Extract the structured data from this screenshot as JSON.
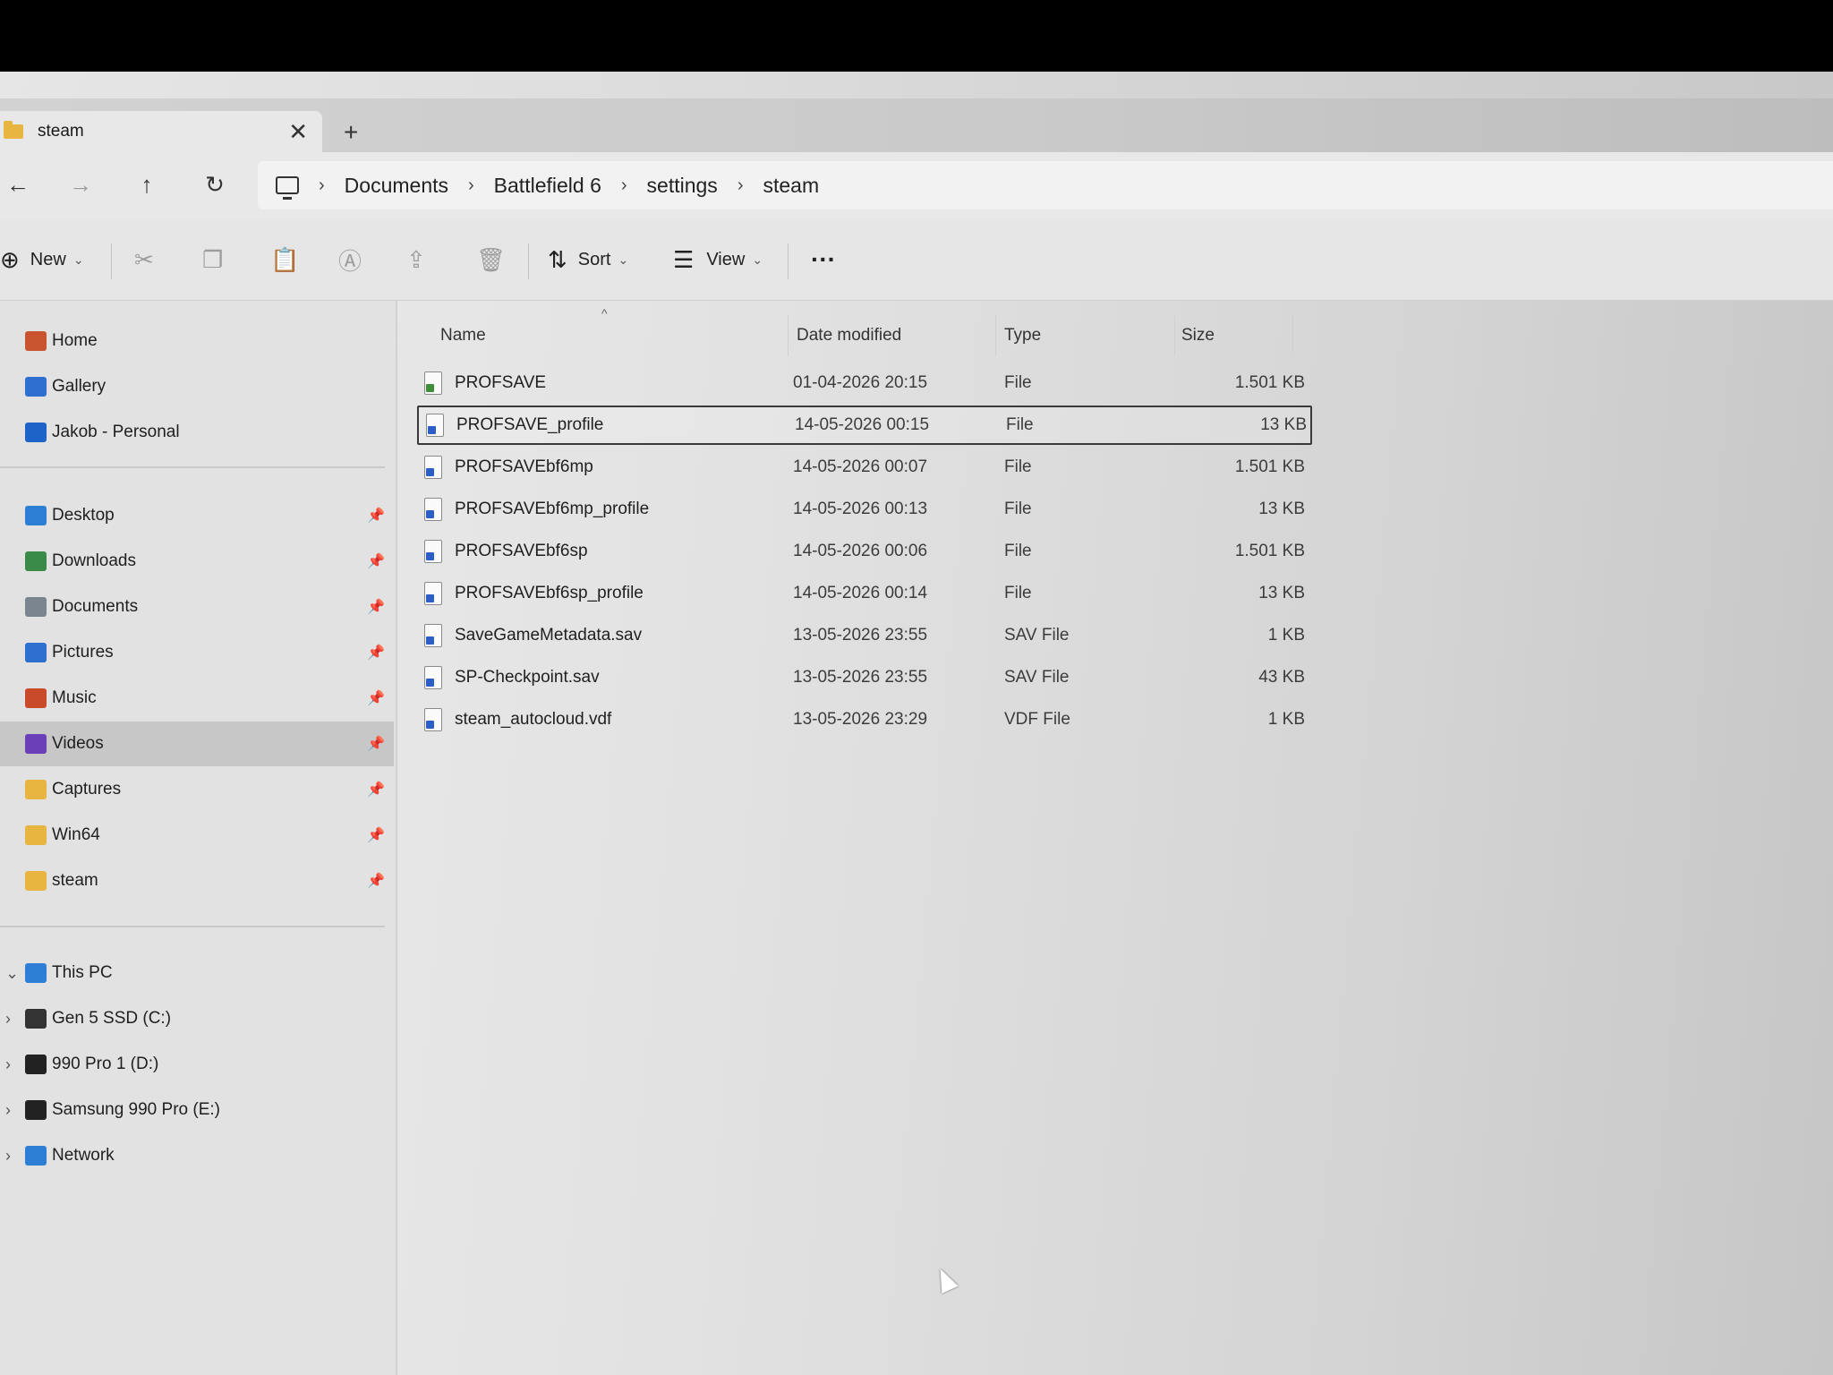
{
  "tab": {
    "title": "steam",
    "close": "✕",
    "new": "+"
  },
  "nav": {
    "back": "←",
    "forward": "→",
    "up": "↑",
    "refresh": "↻"
  },
  "breadcrumb": [
    "Documents",
    "Battlefield 6",
    "settings",
    "steam"
  ],
  "breadcrumb_sep": "›",
  "toolbar": {
    "new_label": "New",
    "sort_label": "Sort",
    "view_label": "View",
    "more_label": "···"
  },
  "columns": {
    "name": "Name",
    "date": "Date modified",
    "type": "Type",
    "size": "Size"
  },
  "files": [
    {
      "name": "PROFSAVE",
      "date": "01-04-2026 20:15",
      "type": "File",
      "size": "1.501 KB",
      "icon": "file-icon"
    },
    {
      "name": "PROFSAVE_profile",
      "date": "14-05-2026 00:15",
      "type": "File",
      "size": "13 KB",
      "icon": "file-icon",
      "selected": true
    },
    {
      "name": "PROFSAVEbf6mp",
      "date": "14-05-2026 00:07",
      "type": "File",
      "size": "1.501 KB",
      "icon": "file-icon"
    },
    {
      "name": "PROFSAVEbf6mp_profile",
      "date": "14-05-2026 00:13",
      "type": "File",
      "size": "13 KB",
      "icon": "file-icon"
    },
    {
      "name": "PROFSAVEbf6sp",
      "date": "14-05-2026 00:06",
      "type": "File",
      "size": "1.501 KB",
      "icon": "file-icon"
    },
    {
      "name": "PROFSAVEbf6sp_profile",
      "date": "14-05-2026 00:14",
      "type": "File",
      "size": "13 KB",
      "icon": "file-icon"
    },
    {
      "name": "SaveGameMetadata.sav",
      "date": "13-05-2026 23:55",
      "type": "SAV File",
      "size": "1 KB",
      "icon": "file-icon"
    },
    {
      "name": "SP-Checkpoint.sav",
      "date": "13-05-2026 23:55",
      "type": "SAV File",
      "size": "43 KB",
      "icon": "file-icon"
    },
    {
      "name": "steam_autocloud.vdf",
      "date": "13-05-2026 23:29",
      "type": "VDF File",
      "size": "1 KB",
      "icon": "file-icon"
    }
  ],
  "sidebar": {
    "top": [
      {
        "label": "Home",
        "icon": "home-icon",
        "color": "#c8552f"
      },
      {
        "label": "Gallery",
        "icon": "gallery-icon",
        "color": "#2f6fd0"
      },
      {
        "label": "Jakob - Personal",
        "icon": "onedrive-icon",
        "color": "#1e64c8"
      }
    ],
    "quick": [
      {
        "label": "Desktop",
        "icon": "desktop-icon",
        "color": "#2d7fd6"
      },
      {
        "label": "Downloads",
        "icon": "downloads-icon",
        "color": "#3a8a4a"
      },
      {
        "label": "Documents",
        "icon": "documents-icon",
        "color": "#7a8590"
      },
      {
        "label": "Pictures",
        "icon": "pictures-icon",
        "color": "#2f6fd0"
      },
      {
        "label": "Music",
        "icon": "music-icon",
        "color": "#c84a2a"
      },
      {
        "label": "Videos",
        "icon": "videos-icon",
        "color": "#6b3fb8",
        "selected": true
      },
      {
        "label": "Captures",
        "icon": "folder-icon",
        "color": "#e8b640"
      },
      {
        "label": "Win64",
        "icon": "folder-icon",
        "color": "#e8b640"
      },
      {
        "label": "steam",
        "icon": "folder-icon",
        "color": "#e8b640"
      }
    ],
    "devices": [
      {
        "label": "This PC",
        "icon": "pc-icon",
        "color": "#2d7fd6",
        "expander": "⌄"
      },
      {
        "label": "Gen 5 SSD (C:)",
        "icon": "drive-icon",
        "color": "#333333",
        "expander": "›"
      },
      {
        "label": "990 Pro 1 (D:)",
        "icon": "drive-icon",
        "color": "#222222",
        "expander": "›"
      },
      {
        "label": "Samsung 990 Pro (E:)",
        "icon": "drive-icon",
        "color": "#222222",
        "expander": "›"
      },
      {
        "label": "Network",
        "icon": "network-icon",
        "color": "#2d7fd6",
        "expander": "›"
      }
    ]
  },
  "pin_glyph": "📌"
}
